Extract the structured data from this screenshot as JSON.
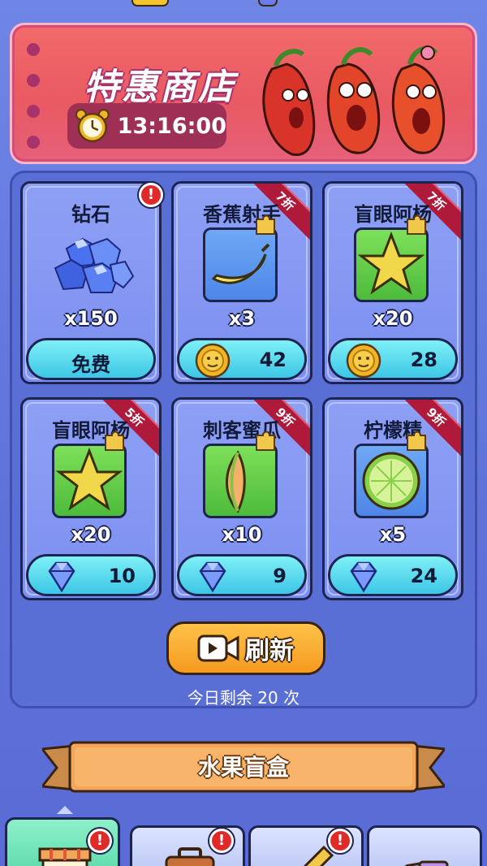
{
  "shop": {
    "title": "特惠商店",
    "timer": "13:16:00"
  },
  "cards": [
    {
      "name": "钻石",
      "qty": "x150",
      "price": "免费",
      "currency": "free",
      "discount": "",
      "alert": "!",
      "item_icon": "diamond-pile-icon"
    },
    {
      "name": "香蕉射手",
      "qty": "x3",
      "price": "42",
      "currency": "coin",
      "discount": "7折",
      "alert": "",
      "item_icon": "banana-icon"
    },
    {
      "name": "盲眼阿杨",
      "qty": "x20",
      "price": "28",
      "currency": "coin",
      "discount": "7折",
      "alert": "",
      "item_icon": "starfruit-icon"
    },
    {
      "name": "盲眼阿杨",
      "qty": "x20",
      "price": "10",
      "currency": "gem",
      "discount": "5折",
      "alert": "",
      "item_icon": "starfruit-icon"
    },
    {
      "name": "刺客蜜瓜",
      "qty": "x10",
      "price": "9",
      "currency": "gem",
      "discount": "9折",
      "alert": "",
      "item_icon": "melon-slice-icon"
    },
    {
      "name": "柠檬精",
      "qty": "x5",
      "price": "24",
      "currency": "gem",
      "discount": "9折",
      "alert": "",
      "item_icon": "lime-slice-icon"
    }
  ],
  "refresh": {
    "label": "刷新",
    "remaining": "今日剩余 20 次"
  },
  "blind_box": {
    "label": "水果盲盒"
  },
  "tabs": [
    {
      "icon": "shop-stall-icon",
      "alert": "!",
      "active": true
    },
    {
      "icon": "briefcase-icon",
      "alert": "!",
      "active": false
    },
    {
      "icon": "rocket-icon",
      "alert": "!",
      "active": false
    },
    {
      "icon": "cards-icon",
      "alert": "",
      "active": false
    }
  ],
  "colors": {
    "background": "#5e72d8",
    "banner": "#e95a62",
    "card": "#8ea0f4",
    "price_button": "#3cc6e6",
    "refresh_button": "#f59a1f",
    "ribbon": "#b01a3a"
  }
}
